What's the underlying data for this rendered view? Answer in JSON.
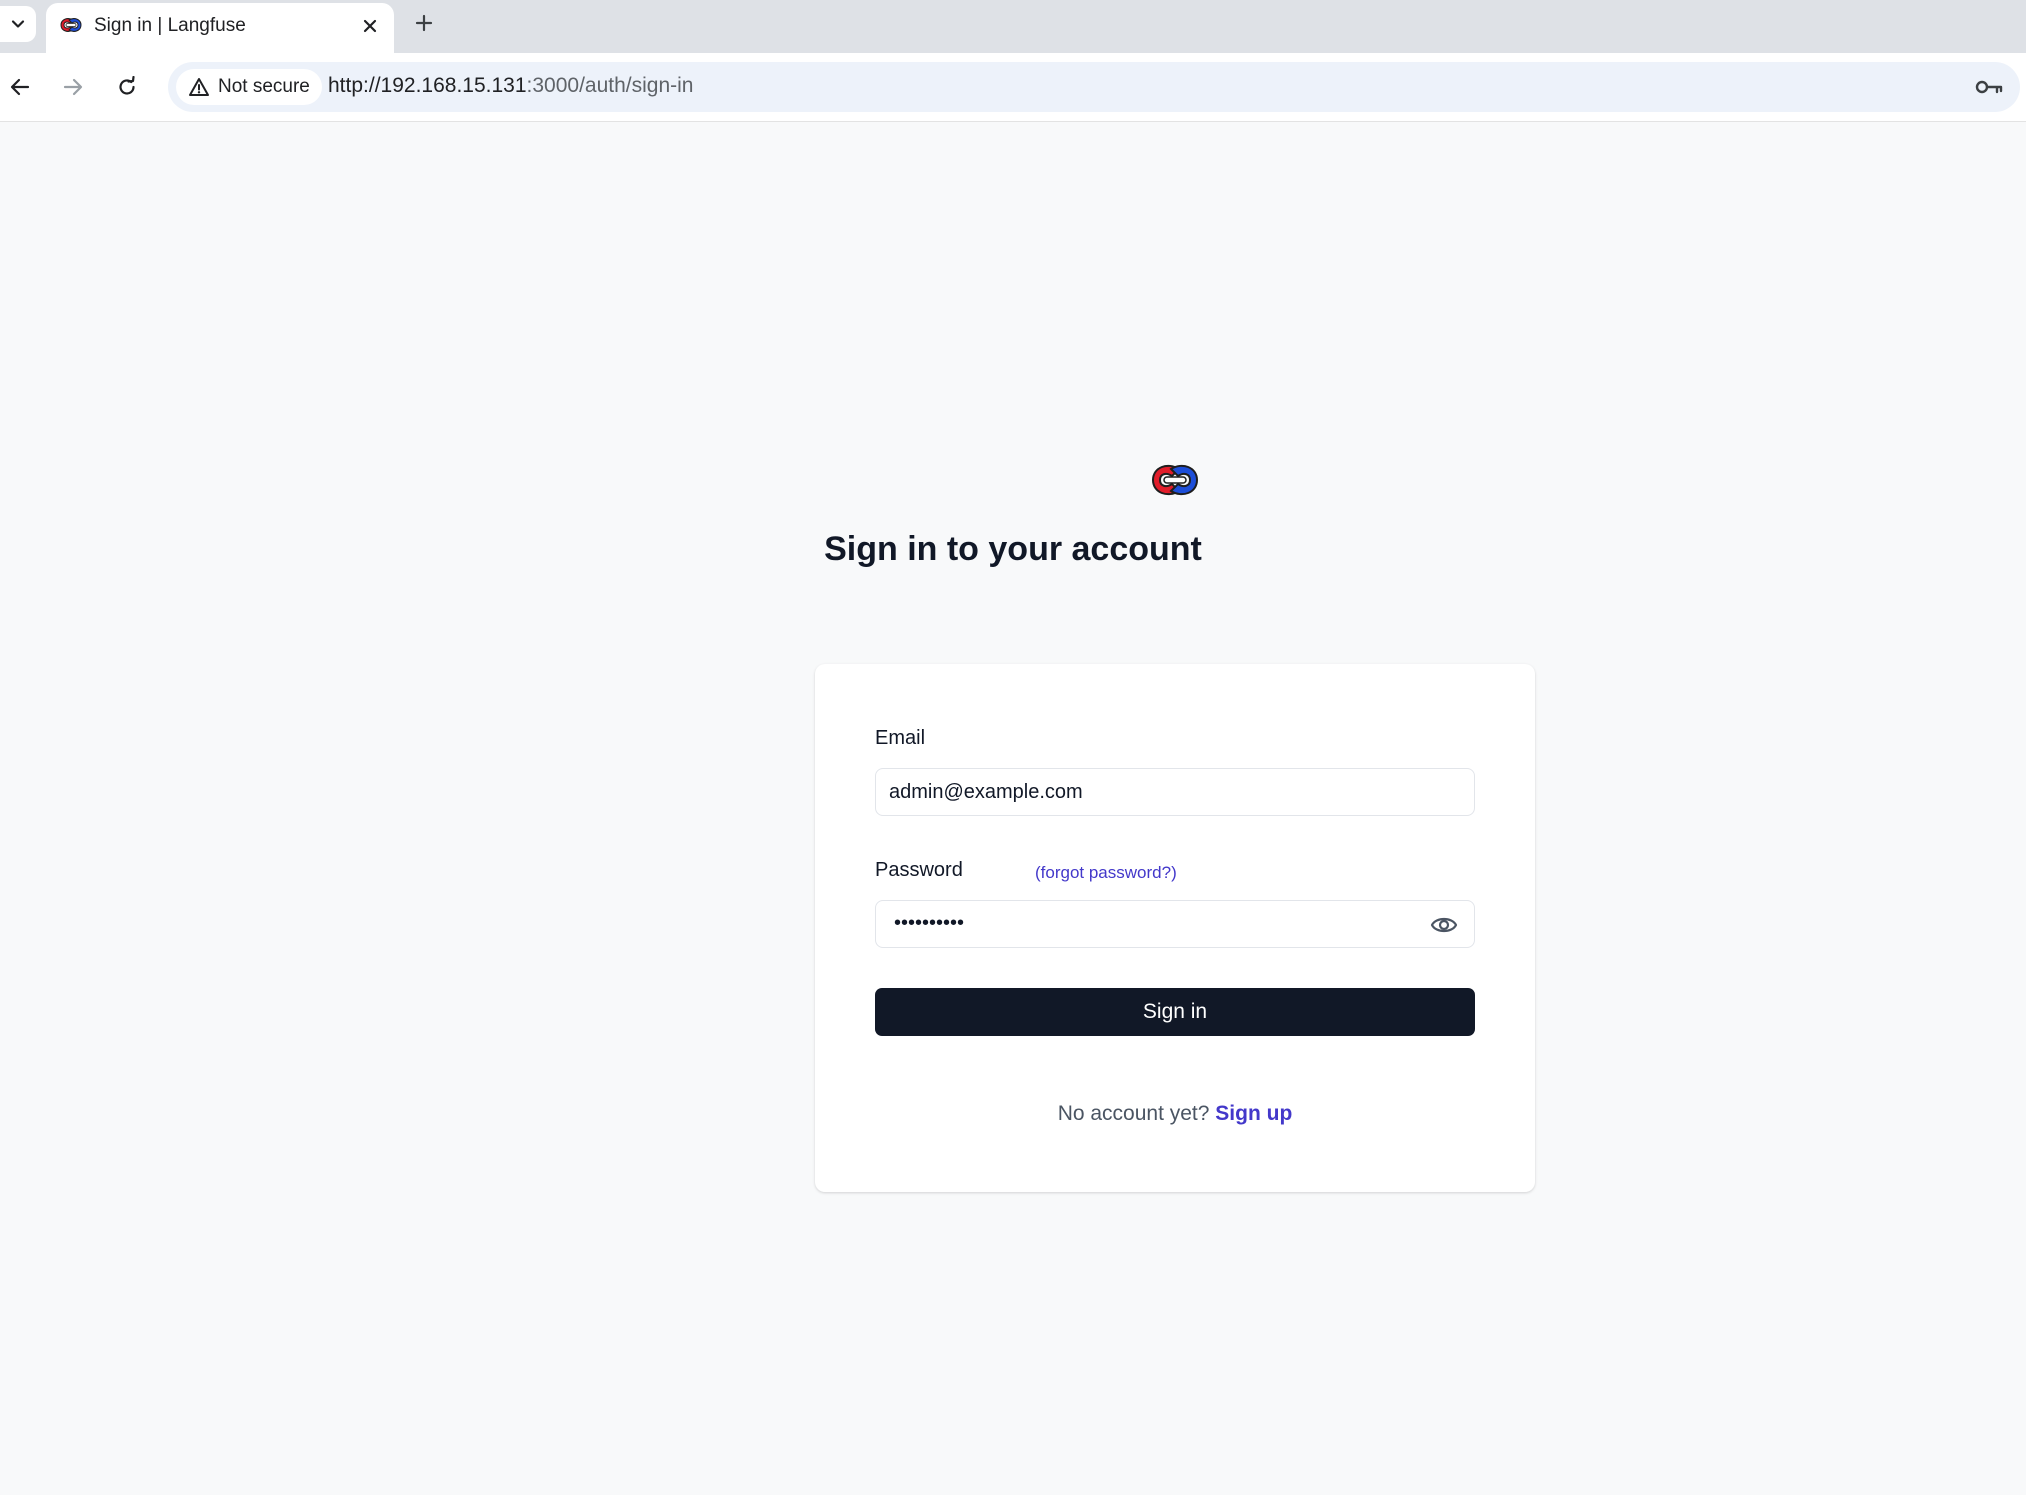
{
  "browser": {
    "tab": {
      "title": "Sign in | Langfuse"
    },
    "security_label": "Not secure",
    "url_host": "http://192.168.15.131",
    "url_path": ":3000/auth/sign-in"
  },
  "page": {
    "heading": "Sign in to your account",
    "form": {
      "email_label": "Email",
      "email_value": "admin@example.com",
      "password_label": "Password",
      "forgot_link": "(forgot password?)",
      "password_dots": "••••••••••",
      "submit_label": "Sign in"
    },
    "signup": {
      "prompt": "No account yet?",
      "link": "Sign up"
    }
  },
  "colors": {
    "accent": "#4338ca",
    "button": "#111827",
    "logo_red": "#e11d2a",
    "logo_blue": "#1d4ed8"
  }
}
